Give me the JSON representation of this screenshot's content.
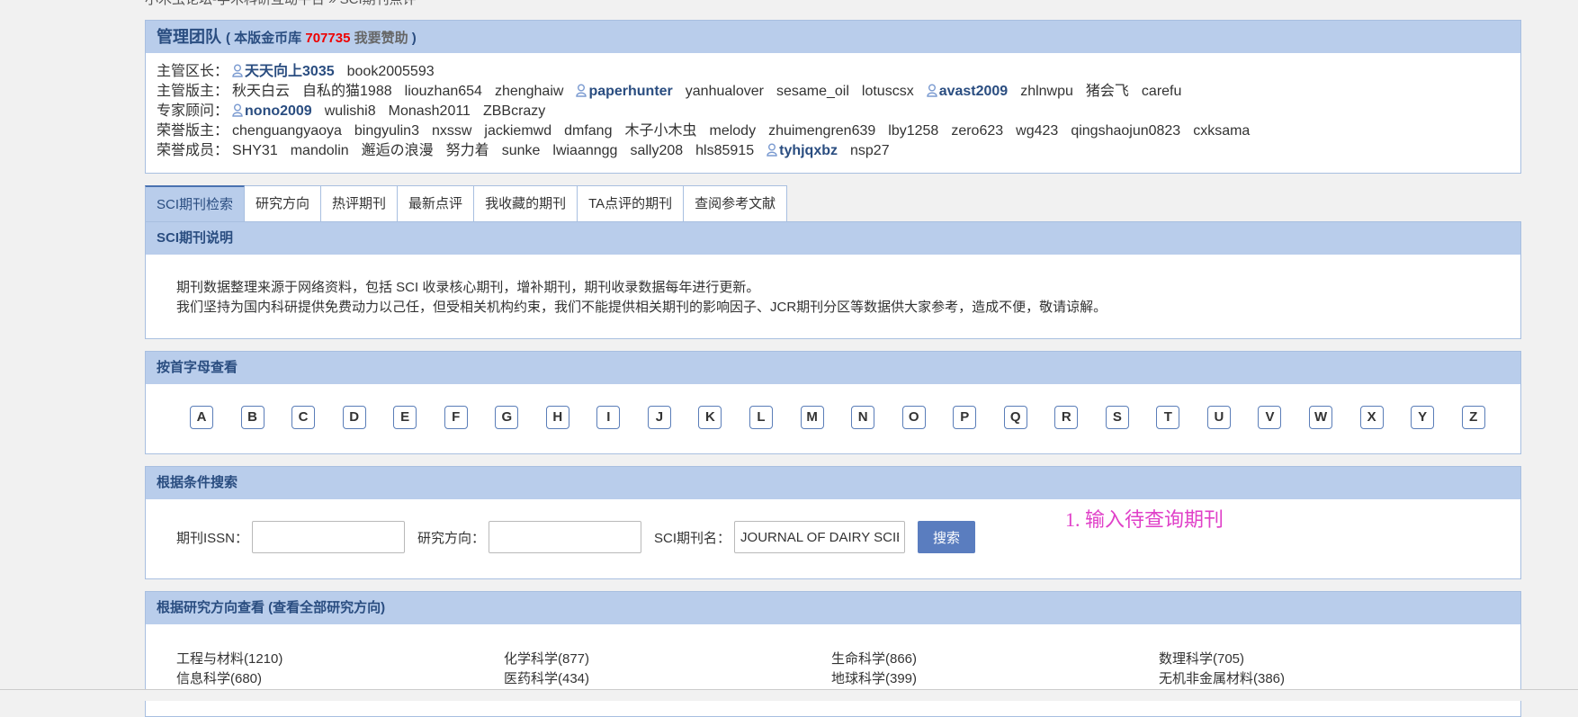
{
  "breadcrumb": "小木虫论坛-学术科研互动平台 » SCI期刊点评",
  "team": {
    "title": "管理团队",
    "gold_prefix": "( 本版金币库",
    "gold_amount": "707735",
    "sponsor": "我要赞助",
    "gold_suffix": ")",
    "rows": [
      {
        "role": "主管区长：",
        "members": [
          {
            "name": "天天向上3035",
            "hl": true
          },
          {
            "name": "book2005593",
            "hl": false
          }
        ]
      },
      {
        "role": "主管版主：",
        "members": [
          {
            "name": "秋天白云",
            "hl": false
          },
          {
            "name": "自私的猫1988",
            "hl": false
          },
          {
            "name": "liouzhan654",
            "hl": false
          },
          {
            "name": "zhenghaiw",
            "hl": false
          },
          {
            "name": "paperhunter",
            "hl": true
          },
          {
            "name": "yanhualover",
            "hl": false
          },
          {
            "name": "sesame_oil",
            "hl": false
          },
          {
            "name": "lotuscsx",
            "hl": false
          },
          {
            "name": "avast2009",
            "hl": true
          },
          {
            "name": "zhlnwpu",
            "hl": false
          },
          {
            "name": "猪会飞",
            "hl": false
          },
          {
            "name": "carefu",
            "hl": false
          }
        ]
      },
      {
        "role": "专家顾问：",
        "members": [
          {
            "name": "nono2009",
            "hl": true
          },
          {
            "name": "wulishi8",
            "hl": false
          },
          {
            "name": "Monash2011",
            "hl": false
          },
          {
            "name": "ZBBcrazy",
            "hl": false
          }
        ]
      },
      {
        "role": "荣誉版主：",
        "members": [
          {
            "name": "chenguangyaoya",
            "hl": false
          },
          {
            "name": "bingyulin3",
            "hl": false
          },
          {
            "name": "nxssw",
            "hl": false
          },
          {
            "name": "jackiemwd",
            "hl": false
          },
          {
            "name": "dmfang",
            "hl": false
          },
          {
            "name": "木子小木虫",
            "hl": false
          },
          {
            "name": "melody",
            "hl": false
          },
          {
            "name": "zhuimengren639",
            "hl": false
          },
          {
            "name": "lby1258",
            "hl": false
          },
          {
            "name": "zero623",
            "hl": false
          },
          {
            "name": "wg423",
            "hl": false
          },
          {
            "name": "qingshaojun0823",
            "hl": false
          },
          {
            "name": "cxksama",
            "hl": false
          }
        ]
      },
      {
        "role": "荣誉成员：",
        "members": [
          {
            "name": "SHY31",
            "hl": false
          },
          {
            "name": "mandolin",
            "hl": false
          },
          {
            "name": "邂逅の浪漫",
            "hl": false
          },
          {
            "name": "努力着",
            "hl": false
          },
          {
            "name": "sunke",
            "hl": false
          },
          {
            "name": "lwiaanngg",
            "hl": false
          },
          {
            "name": "sally208",
            "hl": false
          },
          {
            "name": "hls85915",
            "hl": false
          },
          {
            "name": "tyhjqxbz",
            "hl": true
          },
          {
            "name": "nsp27",
            "hl": false
          }
        ]
      }
    ]
  },
  "tabs": [
    {
      "label": "SCI期刊检索",
      "active": true
    },
    {
      "label": "研究方向",
      "active": false
    },
    {
      "label": "热评期刊",
      "active": false
    },
    {
      "label": "最新点评",
      "active": false
    },
    {
      "label": "我收藏的期刊",
      "active": false
    },
    {
      "label": "TA点评的期刊",
      "active": false
    },
    {
      "label": "查阅参考文献",
      "active": false
    }
  ],
  "description": {
    "title": "SCI期刊说明",
    "line1": "期刊数据整理来源于网络资料，包括 SCI 收录核心期刊，增补期刊，期刊收录数据每年进行更新。",
    "line2": "我们坚持为国内科研提供免费动力以己任，但受相关机构约束，我们不能提供相关期刊的影响因子、JCR期刊分区等数据供大家参考，造成不便，敬请谅解。"
  },
  "letters_panel": {
    "title": "按首字母查看",
    "letters": [
      "A",
      "B",
      "C",
      "D",
      "E",
      "F",
      "G",
      "H",
      "I",
      "J",
      "K",
      "L",
      "M",
      "N",
      "O",
      "P",
      "Q",
      "R",
      "S",
      "T",
      "U",
      "V",
      "W",
      "X",
      "Y",
      "Z"
    ]
  },
  "search_panel": {
    "title": "根据条件搜索",
    "issn_label": "期刊ISSN：",
    "issn_value": "",
    "direction_label": "研究方向：",
    "direction_value": "",
    "name_label": "SCI期刊名：",
    "name_value": "JOURNAL OF DAIRY SCIENCE",
    "button": "搜索"
  },
  "annotation": "1. 输入待查询期刊",
  "directions_panel": {
    "title": "根据研究方向查看 (查看全部研究方向)",
    "items": [
      "工程与材料(1210)",
      "化学科学(877)",
      "生命科学(866)",
      "数理科学(705)",
      "信息科学(680)",
      "医药科学(434)",
      "地球科学(399)",
      "无机非金属材料(386)"
    ]
  },
  "colors": {
    "accent": "#b9cdeb",
    "heading": "#2a4d80",
    "gold": "#ee0000",
    "annotation": "#e040c8",
    "button": "#5a7dbf"
  }
}
